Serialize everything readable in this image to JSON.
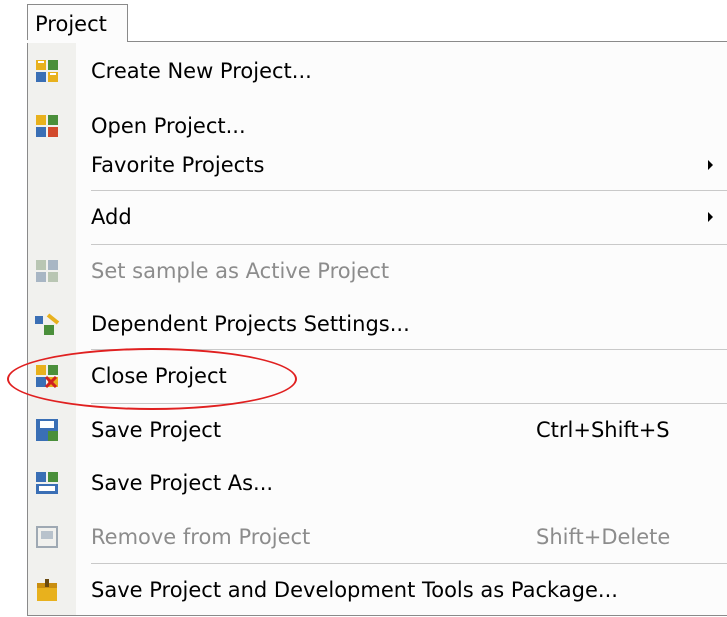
{
  "menu": {
    "title": "Project",
    "items": [
      {
        "name": "menu-item-create-new-project",
        "icon": "new-project-icon",
        "label": "Create New Project...",
        "shortcut": "",
        "disabled": false,
        "submenu": false
      },
      {
        "name": "menu-item-open-project",
        "icon": "open-project-icon",
        "label": "Open Project...",
        "shortcut": "",
        "disabled": false,
        "submenu": false
      },
      {
        "name": "menu-item-favorite-projects",
        "icon": "",
        "label": "Favorite Projects",
        "shortcut": "",
        "disabled": false,
        "submenu": true
      },
      {
        "name": "menu-item-add",
        "icon": "",
        "label": "Add",
        "shortcut": "",
        "disabled": false,
        "submenu": true
      },
      {
        "name": "menu-item-set-active-project",
        "icon": "active-project-icon",
        "label": "Set sample as Active Project",
        "shortcut": "",
        "disabled": true,
        "submenu": false
      },
      {
        "name": "menu-item-dependent-projects-settings",
        "icon": "dependent-projects-icon",
        "label": "Dependent Projects Settings...",
        "shortcut": "",
        "disabled": false,
        "submenu": false
      },
      {
        "name": "menu-item-close-project",
        "icon": "close-project-icon",
        "label": "Close Project",
        "shortcut": "",
        "disabled": false,
        "submenu": false
      },
      {
        "name": "menu-item-save-project",
        "icon": "save-project-icon",
        "label": "Save Project",
        "shortcut": "Ctrl+Shift+S",
        "disabled": false,
        "submenu": false
      },
      {
        "name": "menu-item-save-project-as",
        "icon": "save-project-as-icon",
        "label": "Save Project As...",
        "shortcut": "",
        "disabled": false,
        "submenu": false
      },
      {
        "name": "menu-item-remove-from-project",
        "icon": "remove-from-project-icon",
        "label": "Remove from Project",
        "shortcut": "Shift+Delete",
        "disabled": true,
        "submenu": false
      },
      {
        "name": "menu-item-save-as-package",
        "icon": "package-icon",
        "label": "Save Project and Development Tools as Package...",
        "shortcut": "",
        "disabled": false,
        "submenu": false
      }
    ]
  },
  "colors": {
    "highlight_ellipse": "#e02020",
    "disabled_text": "#8c8c8c",
    "menu_background": "#fcfcfc",
    "icon_gutter": "#f1f1ee"
  }
}
